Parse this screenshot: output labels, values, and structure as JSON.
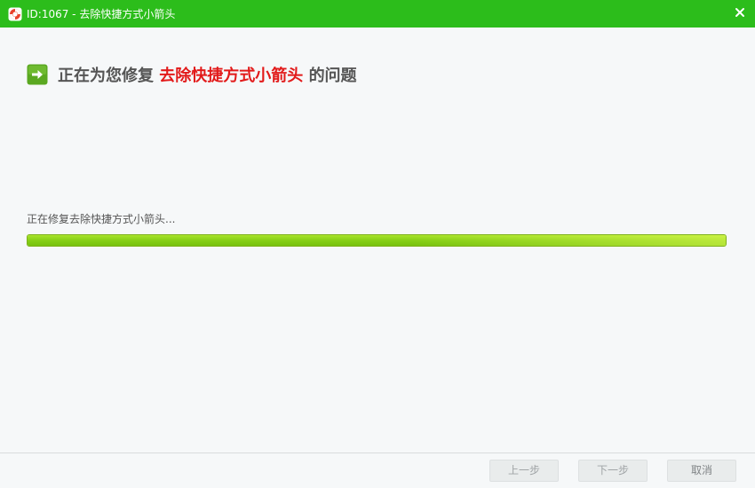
{
  "window": {
    "title": "ID:1067 - 去除快捷方式小箭头",
    "titlebar_color": "#2cbd1b",
    "app_icon": "lifebuoy-icon",
    "close_icon": "close-icon"
  },
  "heading": {
    "icon": "arrow-right-icon",
    "prefix": "正在为您修复",
    "highlight": "去除快捷方式小箭头",
    "suffix": "的问题",
    "highlight_color": "#e21a1a"
  },
  "progress": {
    "status_text": "正在修复去除快捷方式小箭头...",
    "fraction": 1.0,
    "bar_color": "#86cf16"
  },
  "buttons": {
    "prev_label": "上一步",
    "next_label": "下一步",
    "cancel_label": "取消"
  }
}
